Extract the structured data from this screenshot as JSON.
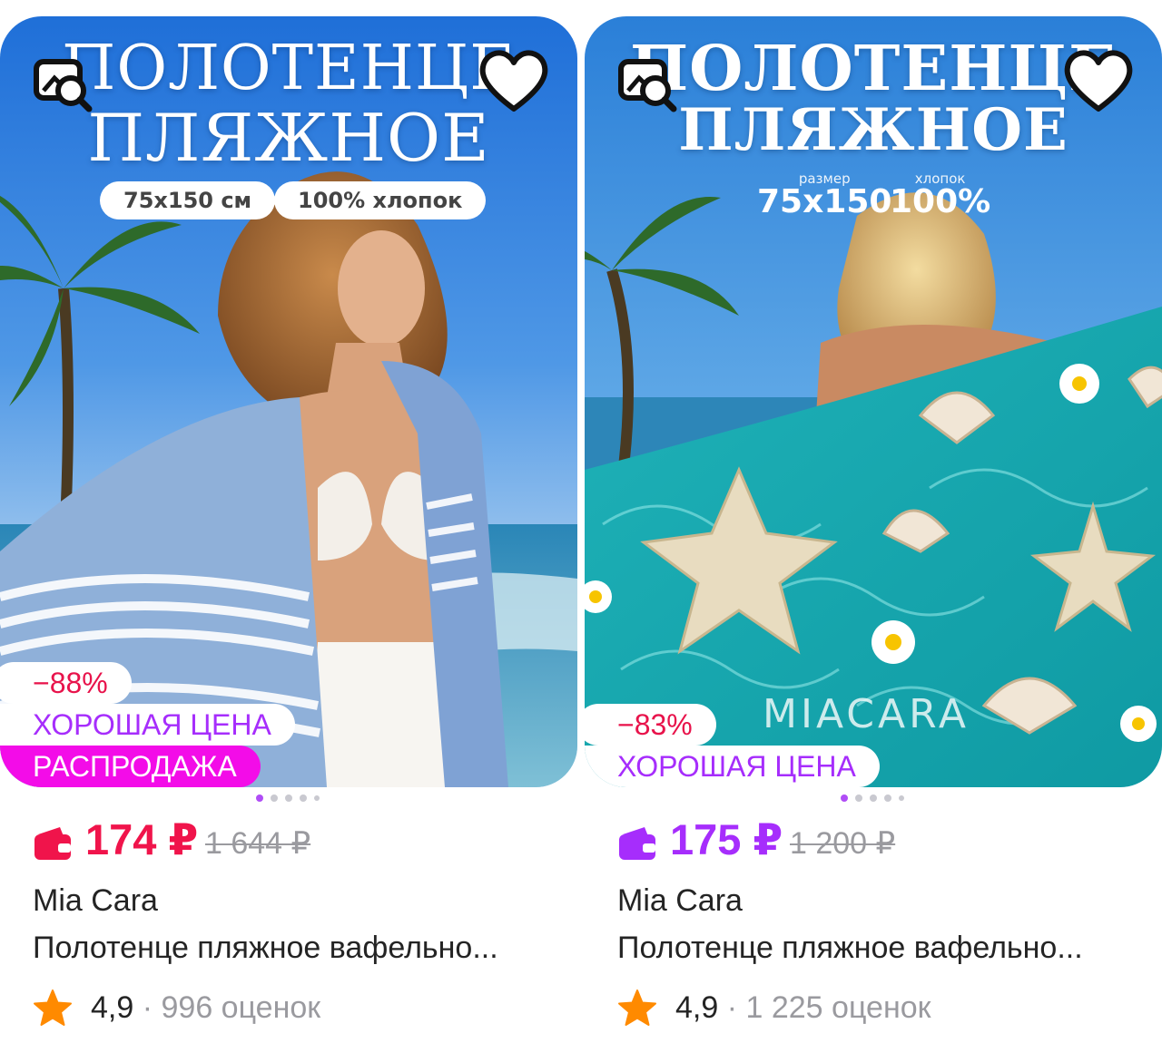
{
  "colors": {
    "discount_red": "#e8134b",
    "good_price_purple": "#a62dfc",
    "sale_magenta": "#f30ce8",
    "price_red": "#f0144b",
    "price_purple": "#a62dfc",
    "star_orange": "#ff8a00",
    "muted_gray": "#9a9a9f"
  },
  "products": [
    {
      "image_title_line1": "ПОЛОТЕНЦЕ",
      "image_title_line2": "ПЛЯЖНОЕ",
      "image_pill_size": "75х150 см",
      "image_pill_material": "100% хлопок",
      "badge_discount": "−88%",
      "badge_good_price": "ХОРОШАЯ ЦЕНА",
      "badge_sale": "РАСПРОДАЖА",
      "carousel_dots": 5,
      "carousel_active": 0,
      "price": "174 ₽",
      "old_price": "1 644 ₽",
      "brand": "Mia Cara",
      "name": "Полотенце пляжное вафельно...",
      "rating": "4,9",
      "separator": "·",
      "reviews": "996 оценок",
      "icons": [
        "image-search-icon",
        "heart-icon",
        "wallet-icon",
        "star-icon"
      ]
    },
    {
      "image_title_line1": "ПОЛОТЕНЦЕ",
      "image_title_line2": "ПЛЯЖНОЕ",
      "image_spec_size_label": "размер",
      "image_spec_size": "75х150",
      "image_spec_material_label": "хлопок",
      "image_spec_material": "100%",
      "image_logo_text": "MIACARA",
      "badge_discount": "−83%",
      "badge_good_price": "ХОРОШАЯ ЦЕНА",
      "carousel_dots": 5,
      "carousel_active": 0,
      "price": "175 ₽",
      "old_price": "1 200 ₽",
      "brand": "Mia Cara",
      "name": "Полотенце пляжное вафельно...",
      "rating": "4,9",
      "separator": "·",
      "reviews": "1 225 оценок",
      "icons": [
        "image-search-icon",
        "heart-icon",
        "wallet-icon",
        "star-icon"
      ]
    }
  ]
}
